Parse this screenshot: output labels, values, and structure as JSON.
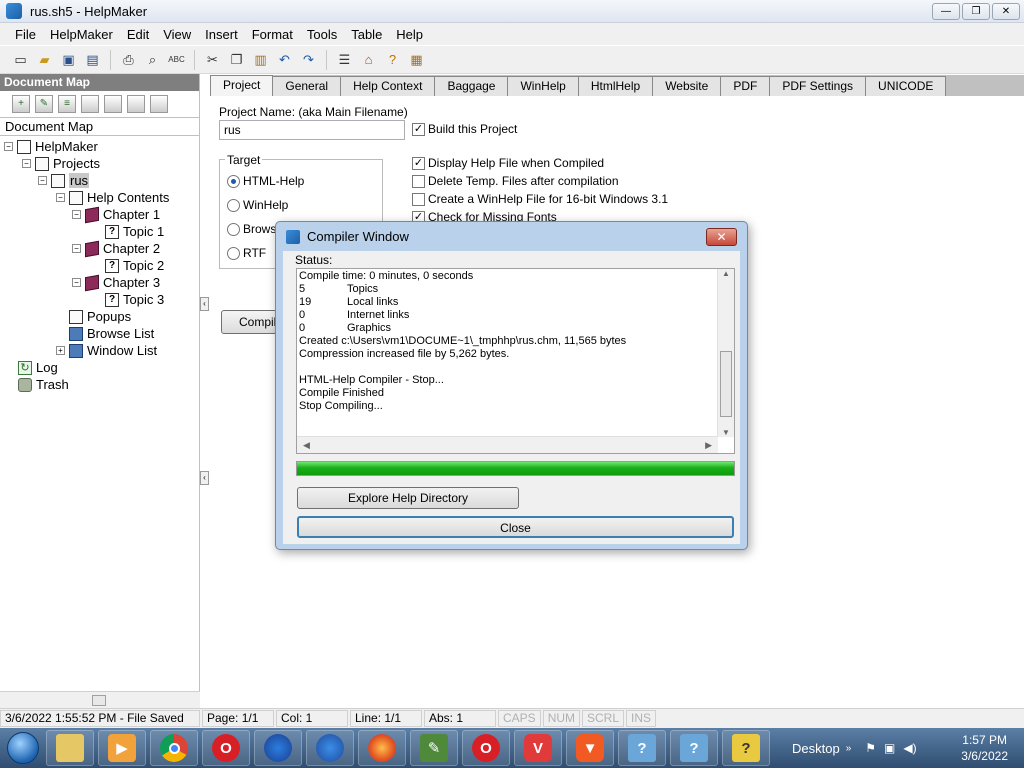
{
  "window": {
    "title": "rus.sh5 - HelpMaker",
    "minimize": "—",
    "maximize": "❐",
    "close": "✕"
  },
  "menu": [
    "File",
    "HelpMaker",
    "Edit",
    "View",
    "Insert",
    "Format",
    "Tools",
    "Table",
    "Help"
  ],
  "toolbar_icons": [
    "new-icon",
    "open-icon",
    "save-icon",
    "save-all-icon",
    "print-icon",
    "print-preview-icon",
    "spellcheck-icon",
    "cut-icon",
    "copy-icon",
    "paste-icon",
    "undo-icon",
    "redo-icon",
    "properties-icon",
    "build-icon",
    "help-icon",
    "book-icon"
  ],
  "docmap": {
    "header": "Document Map",
    "label": "Document Map",
    "tree": {
      "root": "HelpMaker",
      "projects": "Projects",
      "project": "rus",
      "help_contents": "Help Contents",
      "chapter1": "Chapter 1",
      "topic1": "Topic 1",
      "chapter2": "Chapter 2",
      "topic2": "Topic 2",
      "chapter3": "Chapter 3",
      "topic3": "Topic 3",
      "popups": "Popups",
      "browse_list": "Browse List",
      "window_list": "Window List",
      "log": "Log",
      "trash": "Trash"
    }
  },
  "tabs": [
    "Project",
    "General",
    "Help Context",
    "Baggage",
    "WinHelp",
    "HtmlHelp",
    "Website",
    "PDF",
    "PDF Settings",
    "UNICODE"
  ],
  "project": {
    "name_label": "Project Name: (aka Main Filename)",
    "name_value": "rus",
    "build_label": "Build this Project",
    "target_label": "Target",
    "targets": [
      "HTML-Help",
      "WinHelp",
      "Browse",
      "RTF"
    ],
    "display_label": "Display Help File when Compiled",
    "delete_temp_label": "Delete Temp. Files after compilation",
    "winhelp16_label": "Create a WinHelp File for 16-bit Windows 3.1",
    "missing_fonts_label": "Check for Missing Fonts",
    "compile_button": "Compile"
  },
  "compiler_dialog": {
    "title": "Compiler Window",
    "status_label": "Status:",
    "log": [
      {
        "n": "",
        "t": "Compile time: 0 minutes, 0 seconds"
      },
      {
        "n": "5",
        "t": "Topics"
      },
      {
        "n": "19",
        "t": "Local links"
      },
      {
        "n": "0",
        "t": "Internet links"
      },
      {
        "n": "0",
        "t": "Graphics"
      },
      {
        "n": "",
        "t": "Created c:\\Users\\vm1\\DOCUME~1\\_tmphhp\\rus.chm, 11,565 bytes"
      },
      {
        "n": "",
        "t": "Compression increased file by 5,262 bytes."
      },
      {
        "n": "",
        "t": ""
      },
      {
        "n": "",
        "t": "HTML-Help Compiler - Stop..."
      },
      {
        "n": "",
        "t": "Compile Finished"
      },
      {
        "n": "",
        "t": "Stop Compiling..."
      }
    ],
    "progress": 1.0,
    "explore_button": "Explore Help Directory",
    "close_button": "Close"
  },
  "statusbar": {
    "saved": "3/6/2022 1:55:52 PM - File Saved",
    "page": "Page: 1/1",
    "col": "Col: 1",
    "line": "Line: 1/1",
    "abs": "Abs: 1",
    "caps": "CAPS",
    "num": "NUM",
    "scrl": "SCRL",
    "ins": "INS"
  },
  "taskbar": {
    "desktop_label": "Desktop",
    "time": "1:57 PM",
    "date": "3/6/2022"
  },
  "colors": {
    "progress_green": "#19b019",
    "dialog_frame": "#b9d1ea",
    "docmap_header": "#7f7f7f",
    "taskbar": "#2f4d70"
  }
}
